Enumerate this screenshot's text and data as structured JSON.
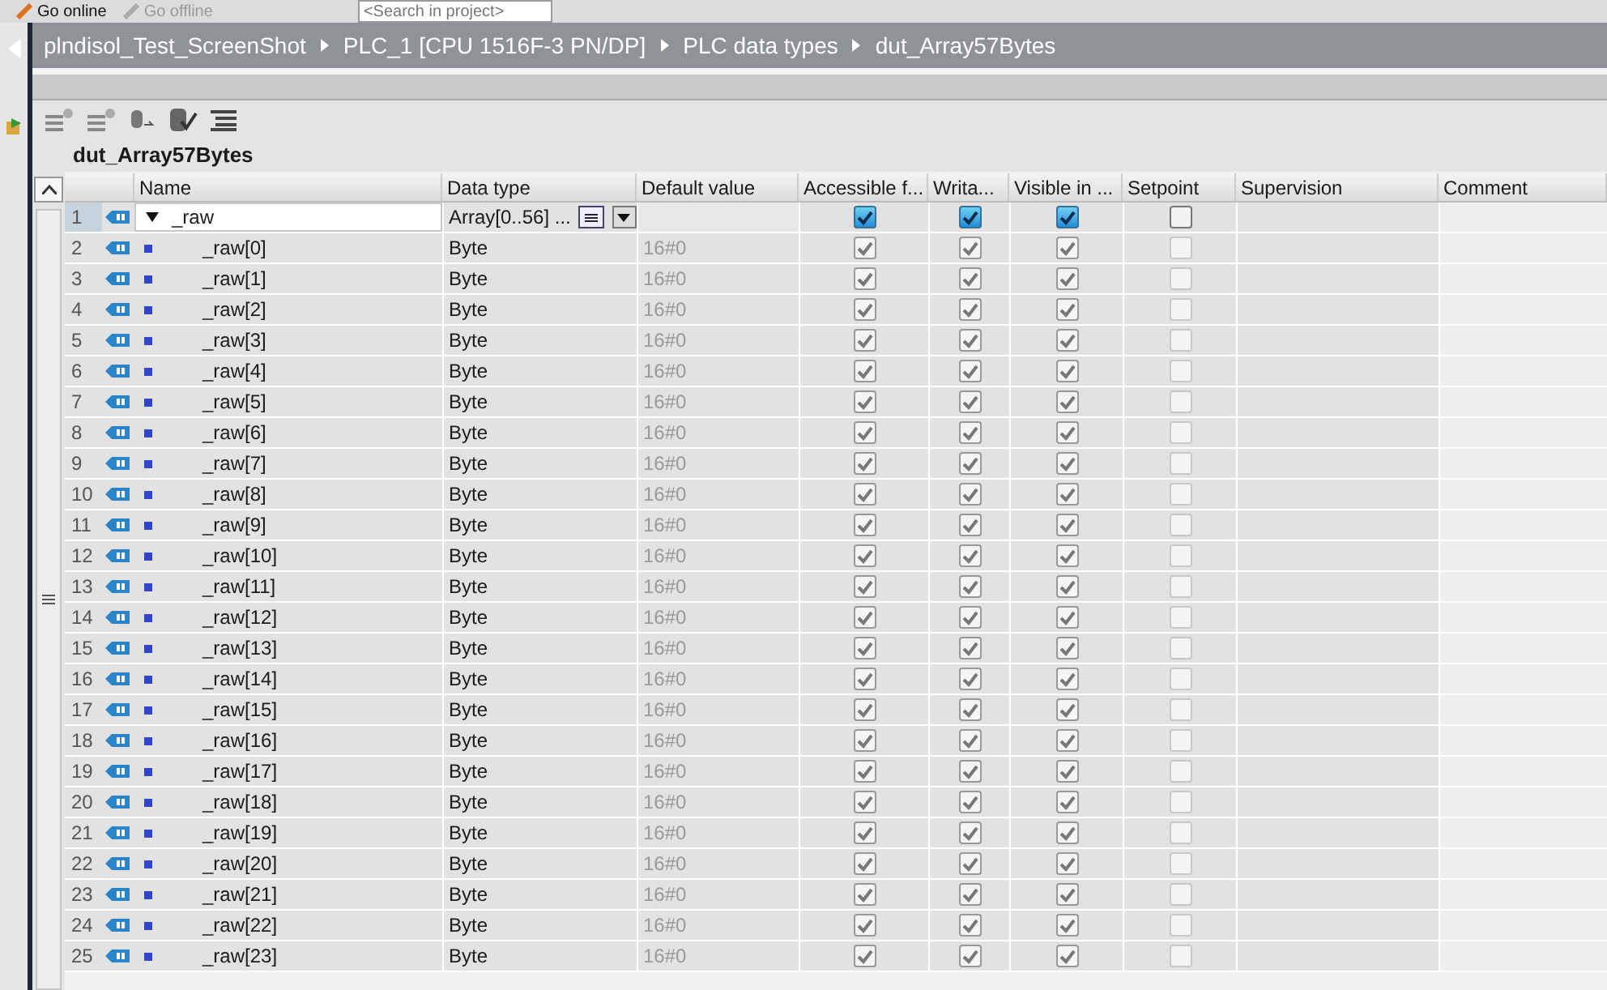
{
  "toolbar": {
    "items": [
      {
        "label": "Go online",
        "disabled": false
      },
      {
        "label": "Go offline",
        "disabled": true
      }
    ],
    "search": {
      "placeholder": "<Search in project>"
    }
  },
  "breadcrumb": [
    "plndisol_Test_ScreenShot",
    "PLC_1 [CPU 1516F-3 PN/DP]",
    "PLC data types",
    "dut_Array57Bytes"
  ],
  "editor_title": "dut_Array57Bytes",
  "table": {
    "columns": [
      "Name",
      "Data type",
      "Default value",
      "Accessible f...",
      "Writa...",
      "Visible in ...",
      "Setpoint",
      "Supervision",
      "Comment"
    ],
    "rows": [
      {
        "number": "1",
        "name": "_raw",
        "data_type": "Array[0..56] ...",
        "default_value": "",
        "accessible": true,
        "writable": true,
        "visible": true,
        "setpoint": false,
        "expanded": true,
        "children": [
          {
            "number": "2",
            "name": "_raw[0]",
            "data_type": "Byte",
            "default_value": "16#0",
            "accessible": true,
            "writable": true,
            "visible": true,
            "setpoint": false
          },
          {
            "number": "3",
            "name": "_raw[1]",
            "data_type": "Byte",
            "default_value": "16#0",
            "accessible": true,
            "writable": true,
            "visible": true,
            "setpoint": false
          },
          {
            "number": "4",
            "name": "_raw[2]",
            "data_type": "Byte",
            "default_value": "16#0",
            "accessible": true,
            "writable": true,
            "visible": true,
            "setpoint": false
          },
          {
            "number": "5",
            "name": "_raw[3]",
            "data_type": "Byte",
            "default_value": "16#0",
            "accessible": true,
            "writable": true,
            "visible": true,
            "setpoint": false
          },
          {
            "number": "6",
            "name": "_raw[4]",
            "data_type": "Byte",
            "default_value": "16#0",
            "accessible": true,
            "writable": true,
            "visible": true,
            "setpoint": false
          },
          {
            "number": "7",
            "name": "_raw[5]",
            "data_type": "Byte",
            "default_value": "16#0",
            "accessible": true,
            "writable": true,
            "visible": true,
            "setpoint": false
          },
          {
            "number": "8",
            "name": "_raw[6]",
            "data_type": "Byte",
            "default_value": "16#0",
            "accessible": true,
            "writable": true,
            "visible": true,
            "setpoint": false
          },
          {
            "number": "9",
            "name": "_raw[7]",
            "data_type": "Byte",
            "default_value": "16#0",
            "accessible": true,
            "writable": true,
            "visible": true,
            "setpoint": false
          },
          {
            "number": "10",
            "name": "_raw[8]",
            "data_type": "Byte",
            "default_value": "16#0",
            "accessible": true,
            "writable": true,
            "visible": true,
            "setpoint": false
          },
          {
            "number": "11",
            "name": "_raw[9]",
            "data_type": "Byte",
            "default_value": "16#0",
            "accessible": true,
            "writable": true,
            "visible": true,
            "setpoint": false
          },
          {
            "number": "12",
            "name": "_raw[10]",
            "data_type": "Byte",
            "default_value": "16#0",
            "accessible": true,
            "writable": true,
            "visible": true,
            "setpoint": false
          },
          {
            "number": "13",
            "name": "_raw[11]",
            "data_type": "Byte",
            "default_value": "16#0",
            "accessible": true,
            "writable": true,
            "visible": true,
            "setpoint": false
          },
          {
            "number": "14",
            "name": "_raw[12]",
            "data_type": "Byte",
            "default_value": "16#0",
            "accessible": true,
            "writable": true,
            "visible": true,
            "setpoint": false
          },
          {
            "number": "15",
            "name": "_raw[13]",
            "data_type": "Byte",
            "default_value": "16#0",
            "accessible": true,
            "writable": true,
            "visible": true,
            "setpoint": false
          },
          {
            "number": "16",
            "name": "_raw[14]",
            "data_type": "Byte",
            "default_value": "16#0",
            "accessible": true,
            "writable": true,
            "visible": true,
            "setpoint": false
          },
          {
            "number": "17",
            "name": "_raw[15]",
            "data_type": "Byte",
            "default_value": "16#0",
            "accessible": true,
            "writable": true,
            "visible": true,
            "setpoint": false
          },
          {
            "number": "18",
            "name": "_raw[16]",
            "data_type": "Byte",
            "default_value": "16#0",
            "accessible": true,
            "writable": true,
            "visible": true,
            "setpoint": false
          },
          {
            "number": "19",
            "name": "_raw[17]",
            "data_type": "Byte",
            "default_value": "16#0",
            "accessible": true,
            "writable": true,
            "visible": true,
            "setpoint": false
          },
          {
            "number": "20",
            "name": "_raw[18]",
            "data_type": "Byte",
            "default_value": "16#0",
            "accessible": true,
            "writable": true,
            "visible": true,
            "setpoint": false
          },
          {
            "number": "21",
            "name": "_raw[19]",
            "data_type": "Byte",
            "default_value": "16#0",
            "accessible": true,
            "writable": true,
            "visible": true,
            "setpoint": false
          },
          {
            "number": "22",
            "name": "_raw[20]",
            "data_type": "Byte",
            "default_value": "16#0",
            "accessible": true,
            "writable": true,
            "visible": true,
            "setpoint": false
          },
          {
            "number": "23",
            "name": "_raw[21]",
            "data_type": "Byte",
            "default_value": "16#0",
            "accessible": true,
            "writable": true,
            "visible": true,
            "setpoint": false
          },
          {
            "number": "24",
            "name": "_raw[22]",
            "data_type": "Byte",
            "default_value": "16#0",
            "accessible": true,
            "writable": true,
            "visible": true,
            "setpoint": false
          },
          {
            "number": "25",
            "name": "_raw[23]",
            "data_type": "Byte",
            "default_value": "16#0",
            "accessible": true,
            "writable": true,
            "visible": true,
            "setpoint": false
          }
        ]
      }
    ]
  }
}
